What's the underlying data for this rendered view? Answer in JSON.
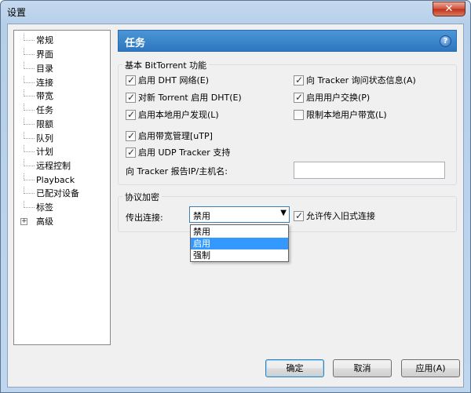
{
  "window": {
    "title": "设置",
    "close_glyph": "✕"
  },
  "tree": {
    "items": [
      {
        "label": "常规"
      },
      {
        "label": "界面"
      },
      {
        "label": "目录"
      },
      {
        "label": "连接"
      },
      {
        "label": "带宽"
      },
      {
        "label": "任务"
      },
      {
        "label": "限额"
      },
      {
        "label": "队列"
      },
      {
        "label": "计划"
      },
      {
        "label": "远程控制"
      },
      {
        "label": "Playback"
      },
      {
        "label": "已配对设备"
      },
      {
        "label": "标签"
      },
      {
        "label": "高级",
        "expander": "+"
      }
    ]
  },
  "panel": {
    "title": "任务",
    "help_glyph": "?"
  },
  "basic_group": {
    "label": "基本 BitTorrent 功能",
    "enable_dht": {
      "label": "启用 DHT 网络(E)",
      "checked": true
    },
    "new_torrent_dht": {
      "label": "对新 Torrent 启用 DHT(E)",
      "checked": true
    },
    "local_peer_discovery": {
      "label": "启用本地用户发现(L)",
      "checked": true
    },
    "bandwidth_mgmt": {
      "label": "启用带宽管理[uTP]",
      "checked": true
    },
    "udp_tracker": {
      "label": "启用 UDP Tracker 支持",
      "checked": true
    },
    "ask_tracker_scrape": {
      "label": "向 Tracker 询问状态信息(A)",
      "checked": true
    },
    "peer_exchange": {
      "label": "启用用户交换(P)",
      "checked": true
    },
    "limit_local_bandwidth": {
      "label": "限制本地用户带宽(L)",
      "checked": false
    },
    "report_ip_label": "向 Tracker 报告IP/主机名:",
    "report_ip_value": ""
  },
  "encryption_group": {
    "label": "协议加密",
    "outgoing_label": "传出连接:",
    "outgoing_value": "禁用",
    "options": [
      "禁用",
      "启用",
      "强制"
    ],
    "highlighted_index": 1,
    "allow_legacy": {
      "label": "允许传入旧式连接",
      "checked": true
    }
  },
  "buttons": {
    "ok": "确定",
    "cancel": "取消",
    "apply": "应用(A)"
  },
  "check_glyph": "✓",
  "dropdown_glyph": "▼"
}
